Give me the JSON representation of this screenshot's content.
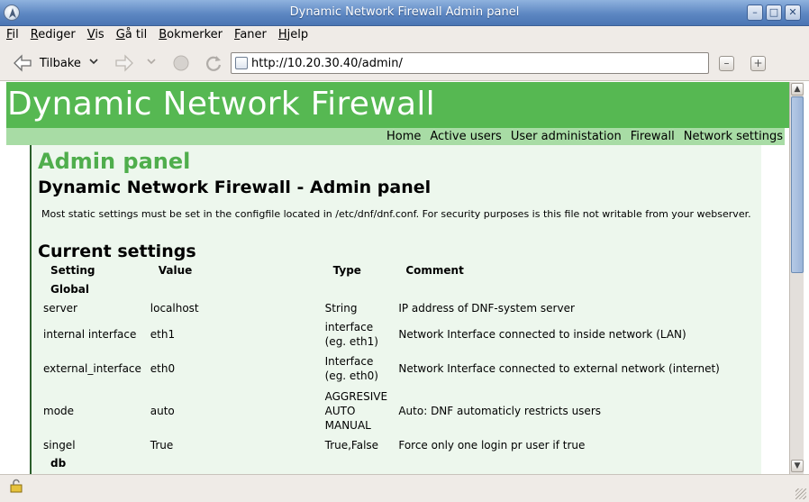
{
  "window": {
    "title": "Dynamic Network Firewall Admin panel"
  },
  "menu": [
    "Fil",
    "Rediger",
    "Vis",
    "Gå til",
    "Bokmerker",
    "Faner",
    "Hjelp"
  ],
  "menu_underline": [
    "F",
    "R",
    "V",
    "G",
    "B",
    "F",
    "H"
  ],
  "toolbar": {
    "back_label": "Tilbake",
    "url": "http://10.20.30.40/admin/"
  },
  "page": {
    "site_title": "Dynamic Network Firewall",
    "nav": [
      "Home",
      "Active users",
      "User administation",
      "Firewall",
      "Network settings"
    ],
    "heading": "Admin panel",
    "subheading": "Dynamic Network Firewall - Admin panel",
    "intro": "Most static settings must be set in the configfile located in /etc/dnf/dnf.conf. For security purposes is this file not writable from your webserver.",
    "section_title": "Current settings",
    "table": {
      "headers": [
        "Setting",
        "Value",
        "Type",
        "Comment"
      ],
      "groups": [
        {
          "name": "Global",
          "rows": [
            {
              "setting": "server",
              "value": "localhost",
              "type": "String",
              "comment": "IP address of DNF-system server"
            },
            {
              "setting": "internal interface",
              "value": "eth1",
              "type": "interface\n(eg. eth1)",
              "comment": "Network Interface connected to inside network (LAN)"
            },
            {
              "setting": "external_interface",
              "value": "eth0",
              "type": "Interface\n(eg. eth0)",
              "comment": "Network Interface connected to external network (internet)"
            },
            {
              "setting": "mode",
              "value": "auto",
              "type": "AGGRESIVE\nAUTO\nMANUAL",
              "comment": "Auto: DNF automaticly restricts users"
            },
            {
              "setting": "singel",
              "value": "True",
              "type": "True,False",
              "comment": "Force only one login pr user if true"
            }
          ]
        },
        {
          "name": "db",
          "rows": []
        }
      ]
    }
  }
}
